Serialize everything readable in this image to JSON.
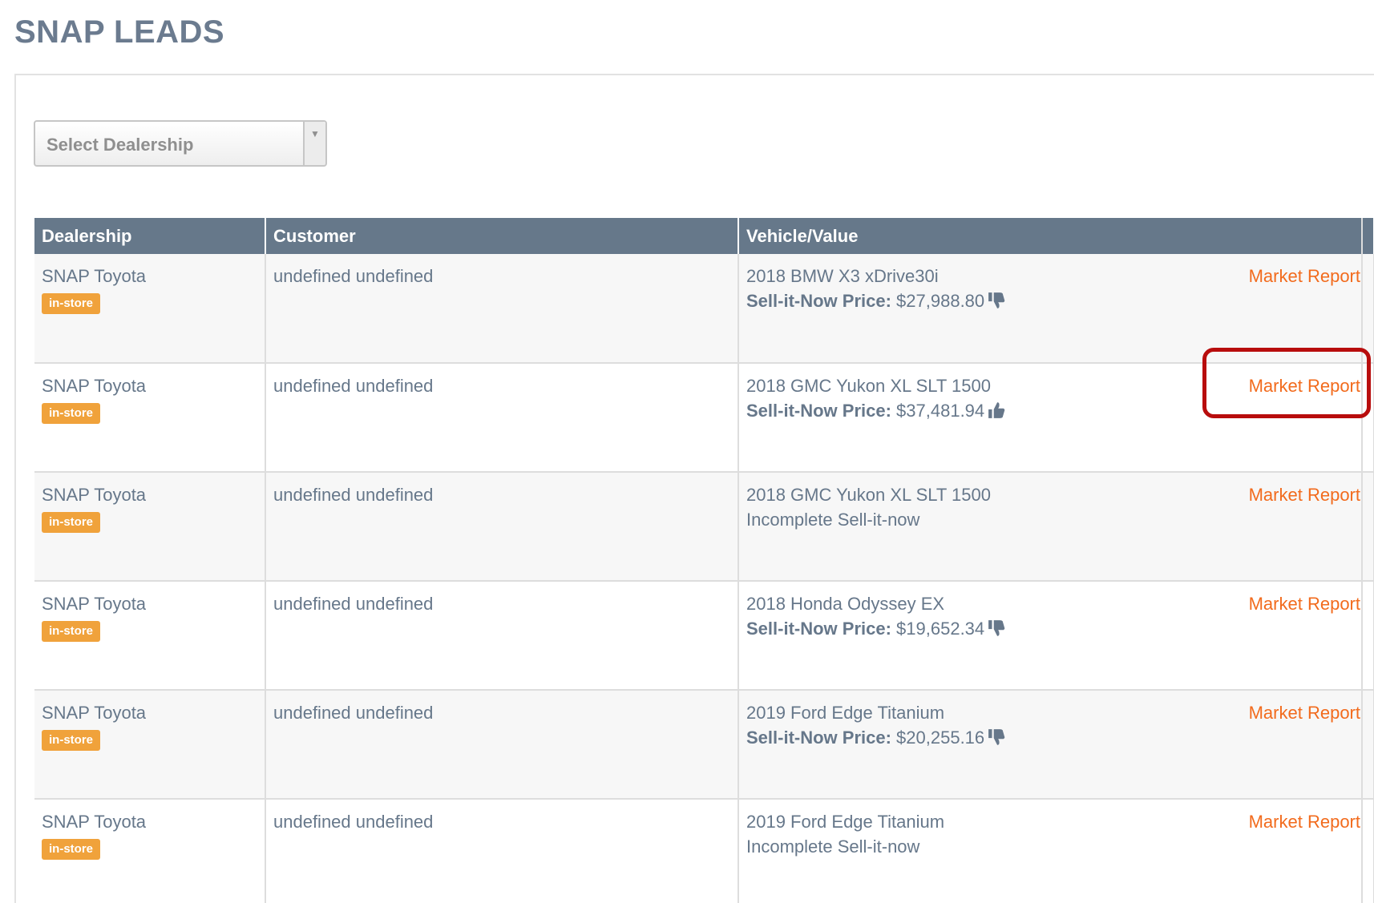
{
  "page": {
    "title": "SNAP LEADS"
  },
  "filter": {
    "placeholder": "Select Dealership"
  },
  "table": {
    "columns": [
      "Dealership",
      "Customer",
      "Vehicle/Value"
    ],
    "rows": [
      {
        "dealership": "SNAP Toyota",
        "badge": "in-store",
        "customer": "undefined undefined",
        "vehicle": "2018 BMW X3 xDrive30i",
        "price_label": "Sell-it-Now Price:",
        "price_value": "$27,988.80",
        "status_text": "",
        "rating_icon": "thumbs-down-icon",
        "link": "Market Report"
      },
      {
        "dealership": "SNAP Toyota",
        "badge": "in-store",
        "customer": "undefined undefined",
        "vehicle": "2018 GMC Yukon XL SLT 1500",
        "price_label": "Sell-it-Now Price:",
        "price_value": "$37,481.94",
        "status_text": "",
        "rating_icon": "thumbs-up-icon",
        "link": "Market Report"
      },
      {
        "dealership": "SNAP Toyota",
        "badge": "in-store",
        "customer": "undefined undefined",
        "vehicle": "2018 GMC Yukon XL SLT 1500",
        "price_label": "",
        "price_value": "",
        "status_text": "Incomplete Sell-it-now",
        "rating_icon": "",
        "link": "Market Report"
      },
      {
        "dealership": "SNAP Toyota",
        "badge": "in-store",
        "customer": "undefined undefined",
        "vehicle": "2018 Honda Odyssey EX",
        "price_label": "Sell-it-Now Price:",
        "price_value": "$19,652.34",
        "status_text": "",
        "rating_icon": "thumbs-down-icon",
        "link": "Market Report"
      },
      {
        "dealership": "SNAP Toyota",
        "badge": "in-store",
        "customer": "undefined undefined",
        "vehicle": "2019 Ford Edge Titanium",
        "price_label": "Sell-it-Now Price:",
        "price_value": "$20,255.16",
        "status_text": "",
        "rating_icon": "thumbs-down-icon",
        "link": "Market Report"
      },
      {
        "dealership": "SNAP Toyota",
        "badge": "in-store",
        "customer": "undefined undefined",
        "vehicle": "2019 Ford Edge Titanium",
        "price_label": "",
        "price_value": "",
        "status_text": "Incomplete Sell-it-now",
        "rating_icon": "",
        "link": "Market Report"
      }
    ]
  },
  "colors": {
    "header_bg": "#66788a",
    "badge": "#f0a23b",
    "link": "#f26b1d",
    "highlight": "#b80d0d"
  }
}
